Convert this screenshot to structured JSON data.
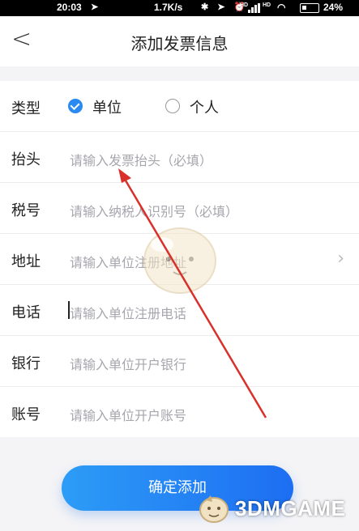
{
  "status_bar": {
    "time": "20:03",
    "location_icon": "location-arrow-icon",
    "net_speed": "1.7K/s",
    "icons": "✱ ➤ ⏰",
    "hd": "HD",
    "battery_pct": "24%"
  },
  "header": {
    "back_icon": "back-chevron-icon",
    "title": "添加发票信息"
  },
  "form": {
    "type": {
      "label": "类型",
      "options": [
        {
          "label": "单位",
          "selected": true
        },
        {
          "label": "个人",
          "selected": false
        }
      ]
    },
    "title_row": {
      "label": "抬头",
      "placeholder": "请输入发票抬头（必填）"
    },
    "tax_row": {
      "label": "税号",
      "placeholder": "请输入纳税人识别号（必填）"
    },
    "address_row": {
      "label": "地址",
      "placeholder": "请输入单位注册地址",
      "chevron": "›"
    },
    "phone_row": {
      "label": "电话",
      "placeholder": "请输入单位注册电话"
    },
    "bank_row": {
      "label": "银行",
      "placeholder": "请输入单位开户银行"
    },
    "account_row": {
      "label": "账号",
      "placeholder": "请输入单位开户账号"
    }
  },
  "confirm_button": {
    "label": "确定添加"
  },
  "watermark": {
    "text": "3DMGAME"
  },
  "colors": {
    "accent": "#2a8af2",
    "button_start": "#2d9cf7",
    "button_end": "#1d6ef2",
    "annotation_arrow": "#d9302a"
  }
}
